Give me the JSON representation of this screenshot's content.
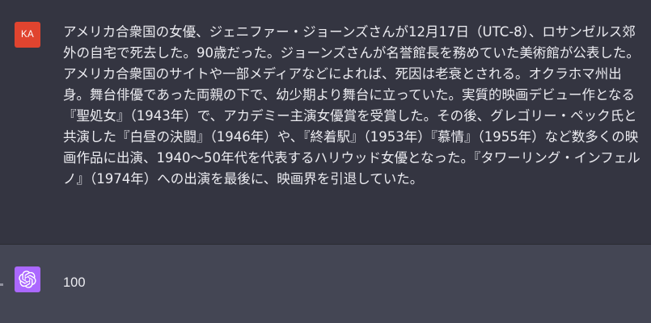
{
  "user_message": {
    "avatar_initials": "KA",
    "avatar_color": "#e0442f",
    "text": "アメリカ合衆国の女優、ジェニファー・ジョーンズさんが12月17日（UTC-8）、ロサンゼルス郊外の自宅で死去した。90歳だった。ジョーンズさんが名誉館長を務めていた美術館が公表した。アメリカ合衆国のサイトや一部メディアなどによれば、死因は老衰とされる。オクラホマ州出身。舞台俳優であった両親の下で、幼少期より舞台に立っていた。実質的映画デビュー作となる『聖処女』（1943年）で、アカデミー主演女優賞を受賞した。その後、グレゴリー・ペック氏と共演した『白昼の決闘』（1946年）や、『終着駅』（1953年）『慕情』（1955年）など数多くの映画作品に出演、1940〜50年代を代表するハリウッド女優となった。『タワーリング・インフェルノ』（1974年）への出演を最後に、映画界を引退していた。"
  },
  "assistant_message": {
    "avatar_icon": "openai-logo-icon",
    "avatar_color": "#ab68ff",
    "text": "100"
  },
  "colors": {
    "user_bg": "#343541",
    "assistant_bg": "#444654",
    "text": "#ececf1"
  }
}
